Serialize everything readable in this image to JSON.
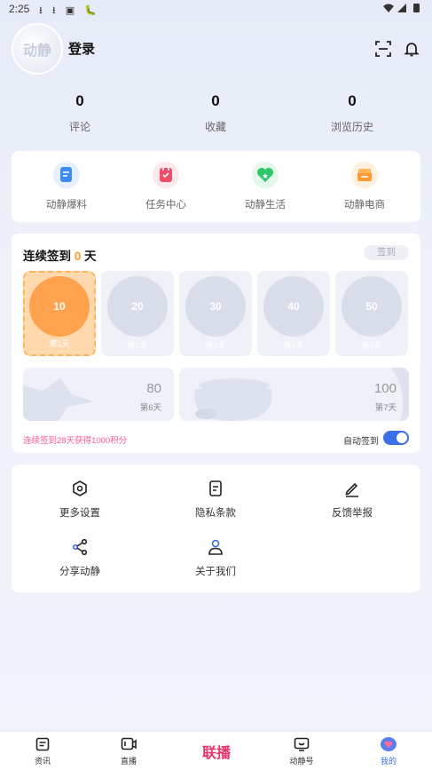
{
  "status_bar": {
    "time": "2:25",
    "icons": "⭳ ⭳ ▣ 🐛"
  },
  "header": {
    "avatar_text": "动静",
    "login": "登录"
  },
  "stats": [
    {
      "value": "0",
      "label": "评论"
    },
    {
      "value": "0",
      "label": "收藏"
    },
    {
      "value": "0",
      "label": "浏览历史"
    }
  ],
  "quick": [
    {
      "label": "动静爆料",
      "color": "#3d8bf0",
      "bg": "#e6f0fd"
    },
    {
      "label": "任务中心",
      "color": "#f04d6b",
      "bg": "#fde8ec"
    },
    {
      "label": "动静生活",
      "color": "#2fc56a",
      "bg": "#e4f7eb"
    },
    {
      "label": "动静电商",
      "color": "#ff9a2e",
      "bg": "#fff0e0"
    }
  ],
  "checkin": {
    "title_prefix": "连续签到",
    "days": "0",
    "title_suffix": "天",
    "button": "签到",
    "items": [
      {
        "points": "10",
        "label": "第1天"
      },
      {
        "points": "20",
        "label": "第2天"
      },
      {
        "points": "30",
        "label": "第3天"
      },
      {
        "points": "40",
        "label": "第4天"
      },
      {
        "points": "50",
        "label": "第5天"
      }
    ],
    "big": [
      {
        "points": "80",
        "label": "第6天"
      },
      {
        "points": "100",
        "label": "第7天"
      }
    ],
    "note": "连续签到28天获得1000积分",
    "auto_label": "自动签到"
  },
  "settings": [
    {
      "label": "更多设置"
    },
    {
      "label": "隐私条款"
    },
    {
      "label": "反馈举报"
    },
    {
      "label": "分享动静"
    },
    {
      "label": "关于我们"
    }
  ],
  "tabs": [
    {
      "label": "资讯"
    },
    {
      "label": "直播"
    },
    {
      "label": "联播"
    },
    {
      "label": "动静号"
    },
    {
      "label": "我的"
    }
  ],
  "colors": {
    "accent": "#3b6ee8",
    "orange": "#ff9a2e",
    "pink": "#ff5a8a"
  }
}
